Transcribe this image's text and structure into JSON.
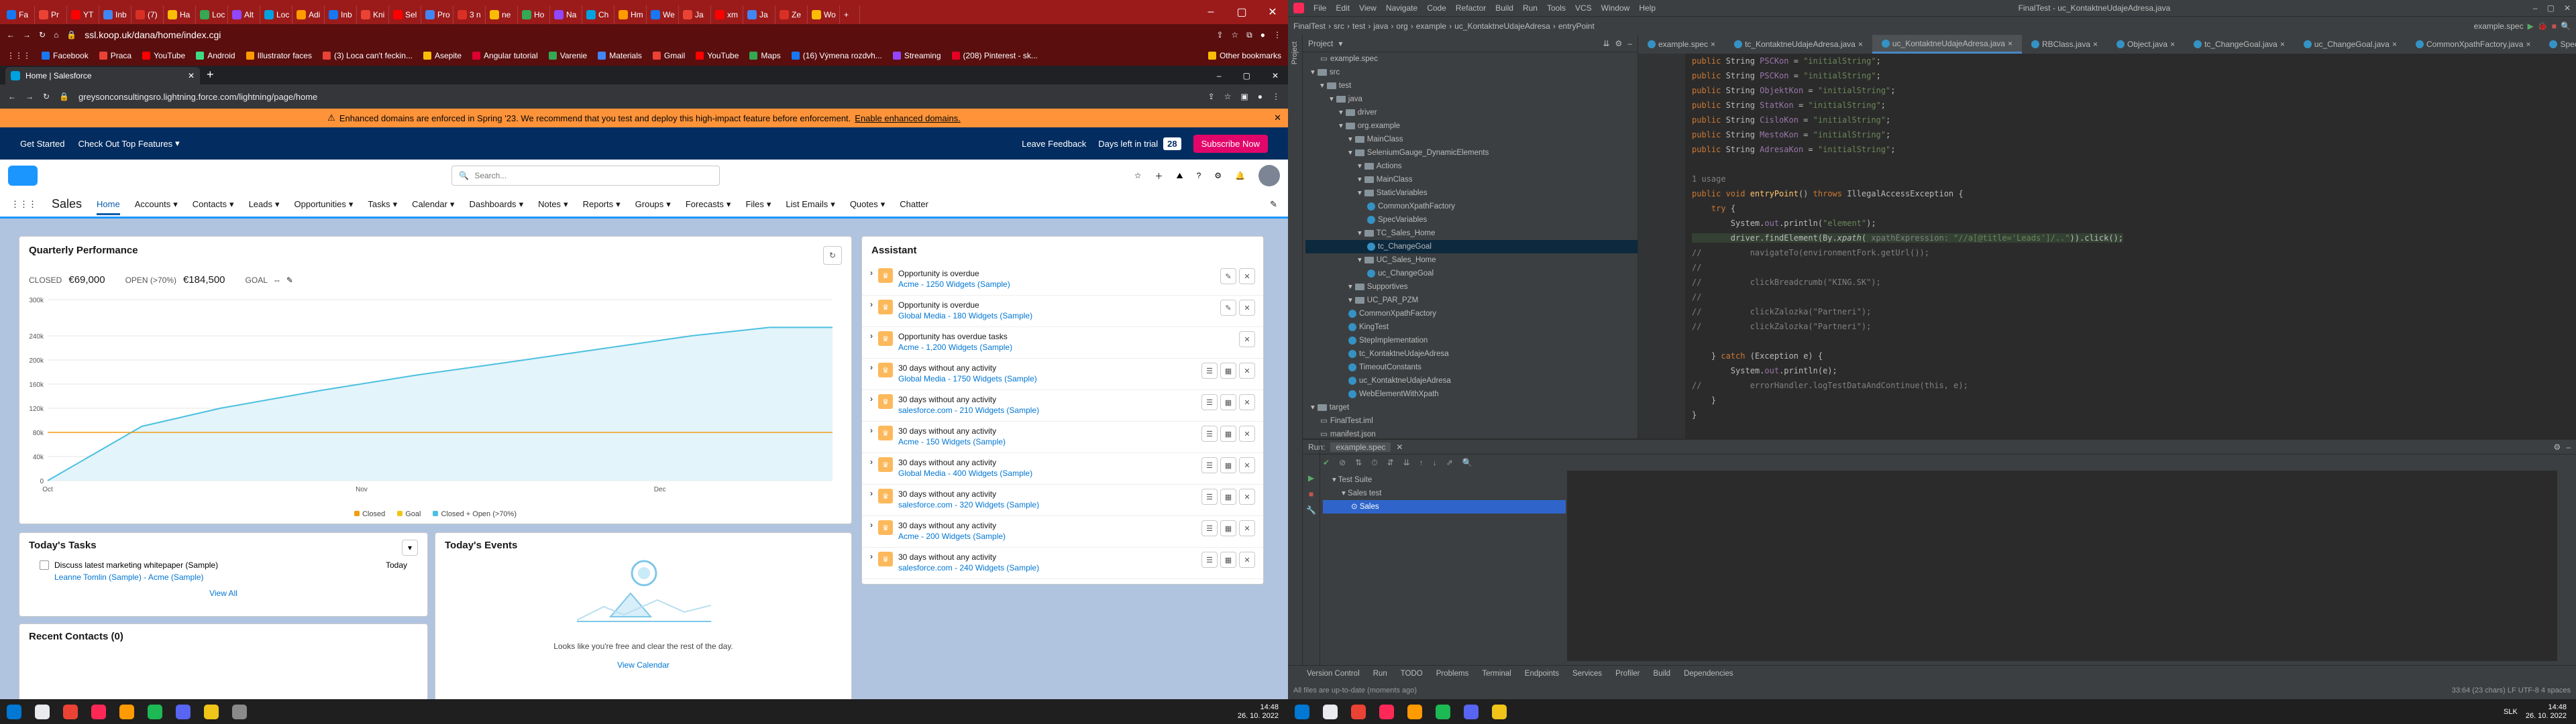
{
  "chrome": {
    "tabs": [
      "Fa",
      "Pr",
      "YT",
      "Inb",
      "(7)",
      "Ha",
      "Loc",
      "Alt",
      "Loc",
      "Adi",
      "Inb",
      "Kni",
      "Sel",
      "Pro",
      "3 n",
      "ne",
      "Ho",
      "Na",
      "Ch",
      "Hm",
      "We",
      "Ja",
      "xm",
      "Ja",
      "Ze",
      "Wo"
    ],
    "active_tab": "",
    "address": "ssl.koop.uk/dana/home/index.cgi",
    "bookmarks": [
      {
        "label": "Facebook",
        "color": "#1877f2"
      },
      {
        "label": "Praca",
        "color": "#ea4335"
      },
      {
        "label": "YouTube",
        "color": "#ff0000"
      },
      {
        "label": "Android",
        "color": "#3ddc84"
      },
      {
        "label": "Illustrator faces",
        "color": "#ff9a00"
      },
      {
        "label": "(3) Loca can't feckin...",
        "color": "#ea4335"
      },
      {
        "label": "Asepite",
        "color": "#fbbc05"
      },
      {
        "label": "Angular tutorial",
        "color": "#dd0031"
      },
      {
        "label": "Varenie",
        "color": "#34a853"
      },
      {
        "label": "Materials",
        "color": "#4285f4"
      },
      {
        "label": "Gmail",
        "color": "#ea4335"
      },
      {
        "label": "YouTube",
        "color": "#ff0000"
      },
      {
        "label": "Maps",
        "color": "#34a853"
      },
      {
        "label": "(16) Výmena rozdvh...",
        "color": "#1877f2"
      },
      {
        "label": "Streaming",
        "color": "#9146ff"
      },
      {
        "label": "(208) Pinterest - sk...",
        "color": "#e60023"
      }
    ],
    "other_bookmarks": "Other bookmarks"
  },
  "inner_window": {
    "tab_title": "Home | Salesforce",
    "address": "greysonconsultingsro.lightning.force.com/lightning/page/home"
  },
  "salesforce": {
    "banner_text": "Enhanced domains are enforced in Spring '23. We recommend that you test and deploy this high-impact feature before enforcement.",
    "banner_link": "Enable enhanced domains.",
    "header": {
      "get_started": "Get Started",
      "top_features": "Check Out Top Features",
      "leave_feedback": "Leave Feedback",
      "days_left": "Days left in trial",
      "days_count": "28",
      "subscribe": "Subscribe Now"
    },
    "search_placeholder": "Search...",
    "app_name": "Sales",
    "nav": [
      "Home",
      "Accounts",
      "Contacts",
      "Leads",
      "Opportunities",
      "Tasks",
      "Calendar",
      "Dashboards",
      "Notes",
      "Reports",
      "Groups",
      "Forecasts",
      "Files",
      "List Emails",
      "Quotes",
      "Chatter"
    ],
    "quarterly": {
      "title": "Quarterly Performance",
      "closed_label": "CLOSED",
      "closed_value": "€69,000",
      "open_label": "OPEN (>70%)",
      "open_value": "€184,500",
      "goal_label": "GOAL",
      "goal_value": "--"
    },
    "assistant": {
      "title": "Assistant",
      "items": [
        {
          "title": "Opportunity is overdue",
          "link": "Acme - 1250 Widgets (Sample)"
        },
        {
          "title": "Opportunity is overdue",
          "link": "Global Media - 180 Widgets (Sample)"
        },
        {
          "title": "Opportunity has overdue tasks",
          "link": "Acme - 1,200 Widgets (Sample)"
        },
        {
          "title": "30 days without any activity",
          "link": "Global Media - 1750 Widgets (Sample)"
        },
        {
          "title": "30 days without any activity",
          "link": "salesforce.com - 210 Widgets (Sample)"
        },
        {
          "title": "30 days without any activity",
          "link": "Acme - 150 Widgets (Sample)"
        },
        {
          "title": "30 days without any activity",
          "link": "Global Media - 400 Widgets (Sample)"
        },
        {
          "title": "30 days without any activity",
          "link": "salesforce.com - 320 Widgets (Sample)"
        },
        {
          "title": "30 days without any activity",
          "link": "Acme - 200 Widgets (Sample)"
        },
        {
          "title": "30 days without any activity",
          "link": "salesforce.com - 240 Widgets (Sample)"
        }
      ]
    },
    "tasks": {
      "title": "Today's Tasks",
      "task_text": "Discuss latest marketing whitepaper (Sample)",
      "task_date": "Today",
      "task_link": "Leanne Tomlin (Sample) - Acme (Sample)",
      "view_all": "View All"
    },
    "events": {
      "title": "Today's Events",
      "empty": "Looks like you're free and clear the rest of the day.",
      "view_calendar": "View Calendar"
    },
    "contacts": {
      "title": "Recent Contacts (0)"
    }
  },
  "chart_data": {
    "type": "line",
    "x_tick_labels": [
      "Oct",
      "Nov",
      "Dec"
    ],
    "y_tick_labels": [
      "0",
      "40k",
      "80k",
      "120k",
      "160k",
      "200k",
      "240k",
      "300k"
    ],
    "ylim": [
      0,
      300000
    ],
    "legend": [
      "Closed",
      "Goal",
      "Closed + Open (>70%)"
    ],
    "series": [
      {
        "name": "Closed + Open (>70%)",
        "color": "#4bc0e0",
        "x": [
          0,
          0.12,
          0.22,
          0.35,
          0.47,
          0.58,
          0.66,
          0.74,
          0.82,
          0.92,
          1.0
        ],
        "values": [
          0,
          90000,
          120000,
          150000,
          175000,
          195000,
          210000,
          225000,
          240000,
          254000,
          254000
        ]
      },
      {
        "name": "Goal",
        "color": "#f39c12",
        "x": [
          0,
          1.0
        ],
        "values": [
          80000,
          80000
        ]
      }
    ]
  },
  "intellij": {
    "window_title": "FinalTest - uc_KontaktneUdajeAdresa.java",
    "menu": [
      "File",
      "Edit",
      "View",
      "Navigate",
      "Code",
      "Refactor",
      "Build",
      "Run",
      "Tools",
      "VCS",
      "Window",
      "Help"
    ],
    "breadcrumb": [
      "FinalTest",
      "src",
      "test",
      "java",
      "org",
      "example",
      "uc_KontaktneUdajeAdresa",
      "entryPoint"
    ],
    "run_config": "example.spec",
    "editor_tabs": [
      "example.spec",
      "tc_KontaktneUdajeAdresa.java",
      "uc_KontaktneUdajeAdresa.java",
      "RBClass.java",
      "Object.java",
      "tc_ChangeGoal.java",
      "uc_ChangeGoal.java",
      "CommonXpathFactory.java",
      "SpecV"
    ],
    "active_editor_tab": "uc_KontaktneUdajeAdresa.java",
    "project_label": "Project",
    "tree": [
      {
        "d": 1,
        "t": "example.spec",
        "k": "file"
      },
      {
        "d": 0,
        "t": "src",
        "k": "folder"
      },
      {
        "d": 1,
        "t": "test",
        "k": "folder"
      },
      {
        "d": 2,
        "t": "java",
        "k": "folder"
      },
      {
        "d": 3,
        "t": "driver",
        "k": "folder"
      },
      {
        "d": 3,
        "t": "org.example",
        "k": "folder"
      },
      {
        "d": 4,
        "t": "MainClass",
        "k": "folder"
      },
      {
        "d": 4,
        "t": "SeleniumGauge_DynamicElements",
        "k": "folder"
      },
      {
        "d": 5,
        "t": "Actions",
        "k": "folder"
      },
      {
        "d": 5,
        "t": "MainClass",
        "k": "folder"
      },
      {
        "d": 5,
        "t": "StaticVariables",
        "k": "folder"
      },
      {
        "d": 6,
        "t": "CommonXpathFactory",
        "k": "class"
      },
      {
        "d": 6,
        "t": "SpecVariables",
        "k": "class"
      },
      {
        "d": 5,
        "t": "TC_Sales_Home",
        "k": "folder"
      },
      {
        "d": 6,
        "t": "tc_ChangeGoal",
        "k": "class"
      },
      {
        "d": 5,
        "t": "UC_Sales_Home",
        "k": "folder"
      },
      {
        "d": 6,
        "t": "uc_ChangeGoal",
        "k": "class"
      },
      {
        "d": 4,
        "t": "Supportives",
        "k": "folder"
      },
      {
        "d": 4,
        "t": "UC_PAR_PZM",
        "k": "folder"
      },
      {
        "d": 4,
        "t": "CommonXpathFactory",
        "k": "class"
      },
      {
        "d": 4,
        "t": "KingTest",
        "k": "class"
      },
      {
        "d": 4,
        "t": "StepImplementation",
        "k": "class"
      },
      {
        "d": 4,
        "t": "tc_KontaktneUdajeAdresa",
        "k": "class"
      },
      {
        "d": 4,
        "t": "TimeoutConstants",
        "k": "class"
      },
      {
        "d": 4,
        "t": "uc_KontaktneUdajeAdresa",
        "k": "class"
      },
      {
        "d": 4,
        "t": "WebElementWithXpath",
        "k": "class"
      },
      {
        "d": 0,
        "t": "target",
        "k": "folder"
      },
      {
        "d": 1,
        "t": "FinalTest.iml",
        "k": "file"
      },
      {
        "d": 1,
        "t": "manifest.json",
        "k": "file"
      }
    ],
    "line_numbers": [
      "",
      "",
      "",
      "",
      "",
      "",
      "",
      "",
      "",
      "",
      "",
      "",
      "",
      "",
      "",
      "",
      "",
      "",
      "",
      "",
      "",
      "",
      "",
      "",
      "",
      ""
    ],
    "run": {
      "tab_run": "Run:",
      "config": "example.spec",
      "tree": [
        "Test Suite",
        "Sales test",
        "Sales"
      ]
    },
    "bottom_tabs": [
      "Version Control",
      "Run",
      "TODO",
      "Problems",
      "Terminal",
      "Endpoints",
      "Services",
      "Profiler",
      "Build",
      "Dependencies"
    ],
    "status_left": "All files are up-to-date (moments ago)",
    "status_right": "33:64 (23 chars)   LF   UTF-8   4 spaces"
  },
  "taskbar": {
    "time": "14:48",
    "date": "26. 10. 2022",
    "lang": "SLK"
  }
}
